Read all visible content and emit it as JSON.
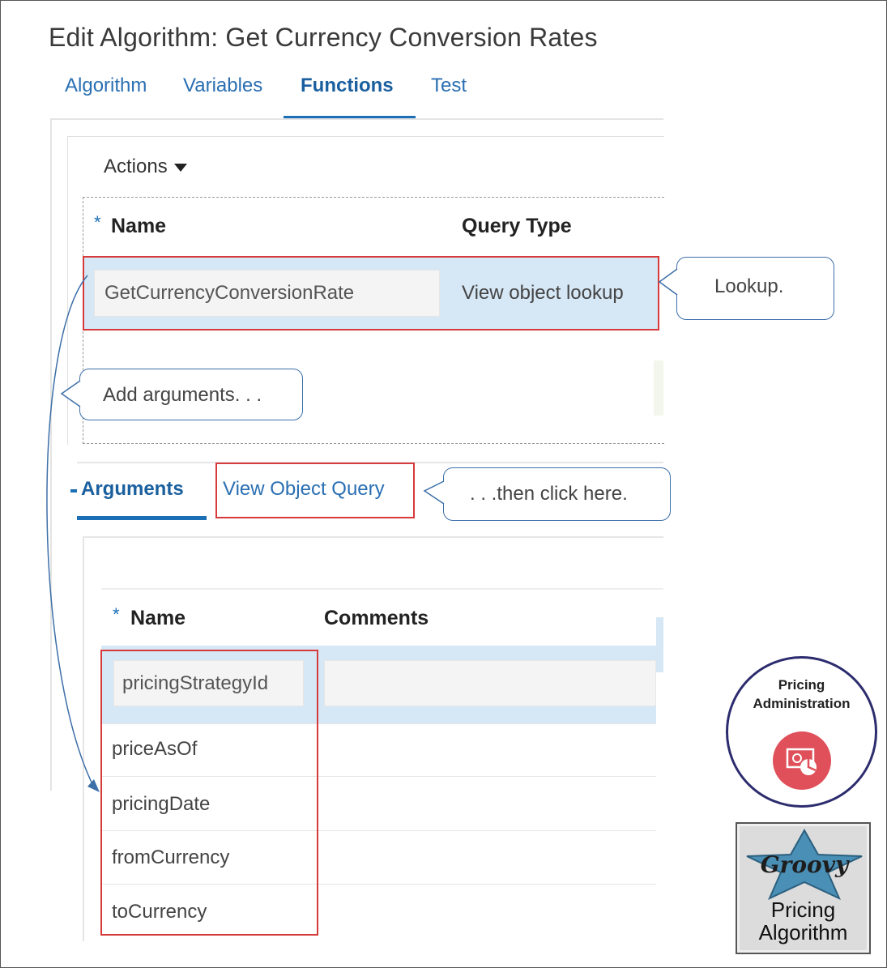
{
  "page": {
    "title": "Edit Algorithm: Get Currency Conversion Rates"
  },
  "tabs": [
    {
      "label": "Algorithm"
    },
    {
      "label": "Variables"
    },
    {
      "label": "Functions"
    },
    {
      "label": "Test"
    }
  ],
  "functions": {
    "actions_label": "Actions",
    "required_marker": "*",
    "columns": {
      "name": "Name",
      "query_type": "Query Type"
    },
    "row": {
      "name": "GetCurrencyConversionRate",
      "query_type": "View object lookup"
    }
  },
  "subtabs": [
    {
      "label": "Arguments"
    },
    {
      "label": "View Object Query"
    }
  ],
  "arguments": {
    "columns": {
      "name": "Name",
      "comments": "Comments"
    },
    "rows": [
      {
        "name": "pricingStrategyId"
      },
      {
        "name": "priceAsOf"
      },
      {
        "name": "pricingDate"
      },
      {
        "name": "fromCurrency"
      },
      {
        "name": "toCurrency"
      }
    ]
  },
  "callouts": {
    "lookup": "Lookup.",
    "add_arguments": "Add arguments. . .",
    "then_click": ". . .then click here."
  },
  "badges": {
    "pricing_admin": {
      "line1": "Pricing",
      "line2": "Administration"
    },
    "groovy": {
      "logo_text": "Groovy",
      "line1": "Pricing",
      "line2": "Algorithm"
    }
  },
  "colors": {
    "accent": "#1a6fb5",
    "highlight_border": "#d63a3a",
    "selected_row": "#d6e7f5",
    "callout_border": "#3d6fa8"
  }
}
